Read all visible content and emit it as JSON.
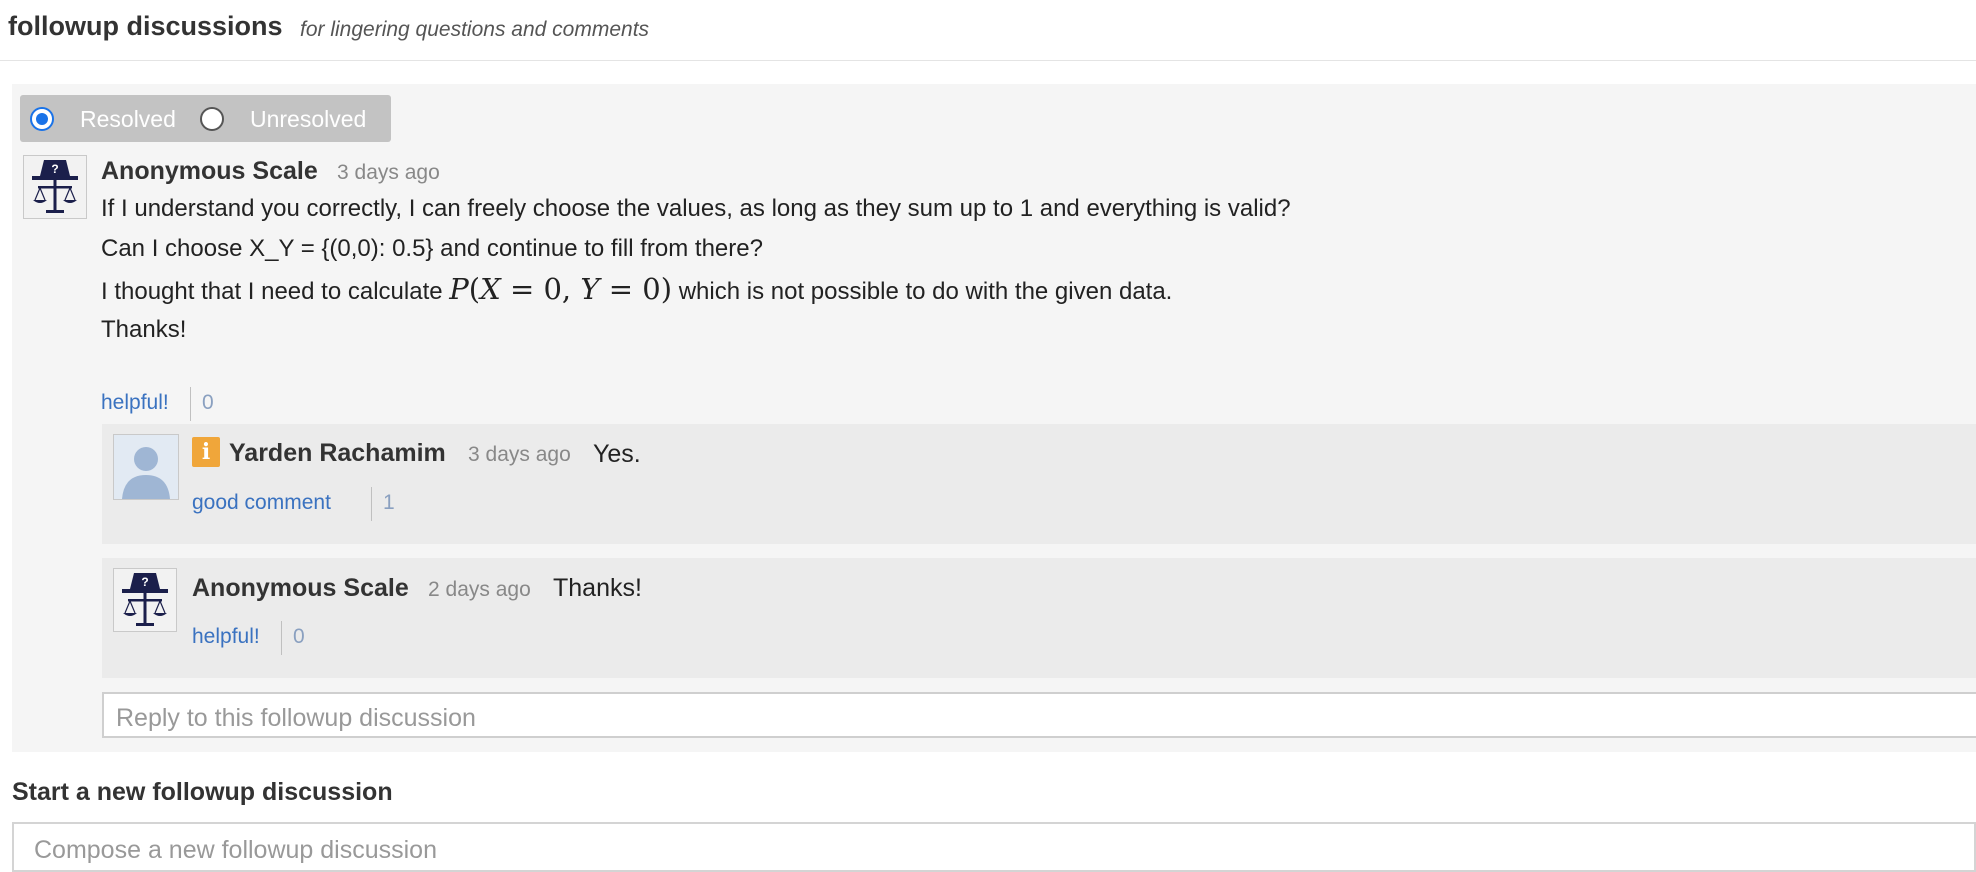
{
  "header": {
    "title": "followup discussions",
    "subtitle": "for lingering questions and comments"
  },
  "resolve": {
    "resolved_label": "Resolved",
    "unresolved_label": "Unresolved",
    "selected": "Resolved"
  },
  "main_post": {
    "author": "Anonymous Scale",
    "timestamp": "3 days ago",
    "lines": [
      "If I understand you correctly, I can freely choose the values, as long as they sum up to 1 and everything is valid?",
      "Can I choose X_Y = {(0,0): 0.5} and continue to fill from there?",
      "I thought that I need to calculate",
      "which is not possible to do with the given data.",
      "Thanks!"
    ],
    "math": {
      "func": "P",
      "open": "(",
      "x": "X",
      "eq1": " = 0, ",
      "y": "Y",
      "eq2": " = 0",
      "close": ")"
    },
    "helpful_label": "helpful!",
    "helpful_count": "0"
  },
  "replies": [
    {
      "author": "Yarden Rachamim",
      "timestamp": "3 days ago",
      "text": "Yes.",
      "badge": "i",
      "action_label": "good comment",
      "count": "1"
    },
    {
      "author": "Anonymous Scale",
      "timestamp": "2 days ago",
      "text": "Thanks!",
      "action_label": "helpful!",
      "count": "0"
    }
  ],
  "reply_input": {
    "placeholder": "Reply to this followup discussion"
  },
  "new_discussion": {
    "heading": "Start a new followup discussion",
    "placeholder": "Compose a new followup discussion"
  },
  "colors": {
    "accent": "#1a73e8",
    "link": "#3a72c0",
    "instructor_badge": "#f0a63a",
    "anon_avatar": "#1b1f4b"
  }
}
